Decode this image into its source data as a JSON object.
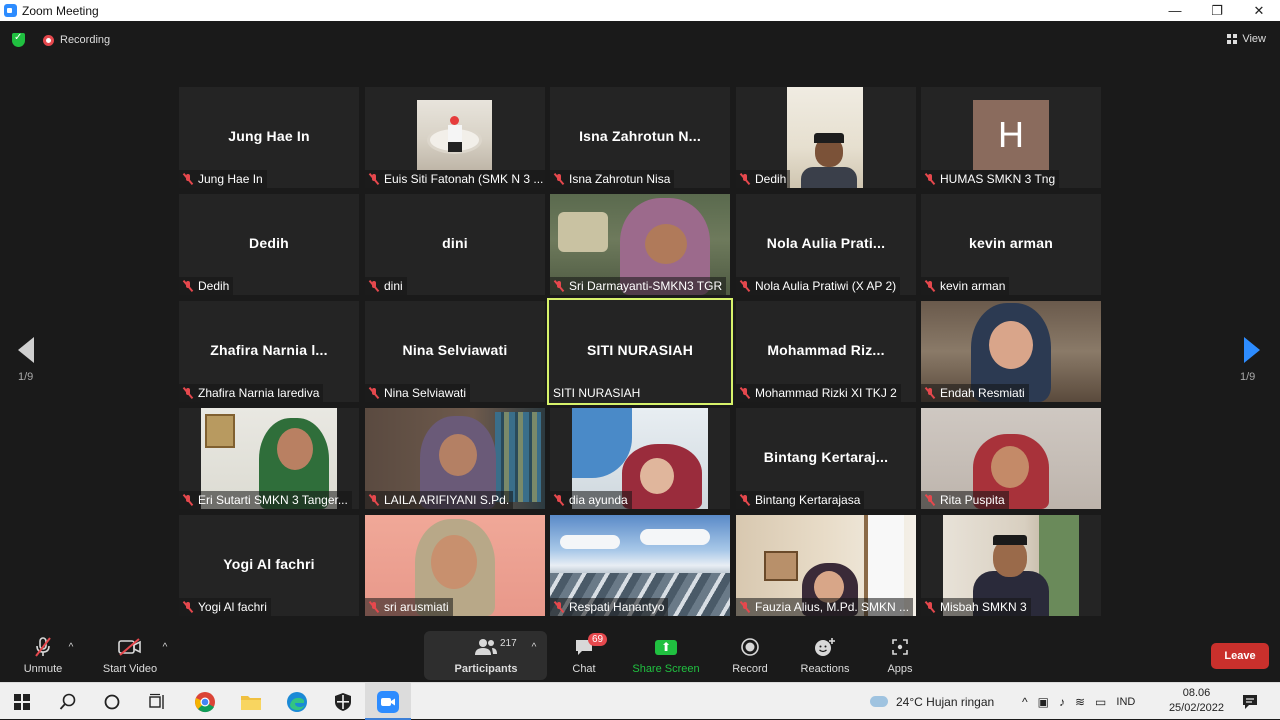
{
  "window": {
    "title": "Zoom Meeting",
    "minimize": "—",
    "restore": "❐",
    "close": "✕"
  },
  "topbar": {
    "recording_label": "Recording",
    "view_label": "View"
  },
  "pager": {
    "left_page": "1/9",
    "right_page": "1/9"
  },
  "tiles": [
    {
      "big": "Jung Hae In",
      "label": "Jung Hae In"
    },
    {
      "big": "",
      "label": "Euis Siti Fatonah (SMK N 3 ..."
    },
    {
      "big": "Isna Zahrotun N...",
      "label": "Isna Zahrotun Nisa"
    },
    {
      "big": "",
      "label": "Dedih"
    },
    {
      "big": "",
      "label": "HUMAS SMKN 3 Tng",
      "avatar": "H"
    },
    {
      "big": "Dedih",
      "label": "Dedih"
    },
    {
      "big": "dini",
      "label": "dini"
    },
    {
      "big": "",
      "label": "Sri Darmayanti-SMKN3 TGR"
    },
    {
      "big": "Nola Aulia Prati...",
      "label": "Nola Aulia Pratiwi (X AP 2)"
    },
    {
      "big": "kevin arman",
      "label": "kevin arman"
    },
    {
      "big": "Zhafira Narnia l...",
      "label": "Zhafira Narnia larediva"
    },
    {
      "big": "Nina Selviawati",
      "label": "Nina Selviawati"
    },
    {
      "big": "SITI NURASIAH",
      "label": "SITI NURASIAH"
    },
    {
      "big": "Mohammad Riz...",
      "label": "Mohammad Rizki XI TKJ 2"
    },
    {
      "big": "",
      "label": "Endah Resmiati"
    },
    {
      "big": "",
      "label": "Eri Sutarti SMKN 3 Tanger..."
    },
    {
      "big": "",
      "label": "LAILA ARIFIYANI S.Pd."
    },
    {
      "big": "",
      "label": "dia ayunda"
    },
    {
      "big": "Bintang Kertaraj...",
      "label": "Bintang Kertarajasa"
    },
    {
      "big": "",
      "label": "Rita Puspita"
    },
    {
      "big": "Yogi Al fachri",
      "label": "Yogi Al fachri"
    },
    {
      "big": "",
      "label": "sri arusmiati"
    },
    {
      "big": "",
      "label": "Respati Hanantyo"
    },
    {
      "big": "",
      "label": "Fauzia Alius, M.Pd. SMKN ..."
    },
    {
      "big": "",
      "label": "Misbah SMKN 3"
    }
  ],
  "toolbar": {
    "unmute": "Unmute",
    "start_video": "Start Video",
    "participants": "Participants",
    "participants_count": "217",
    "chat": "Chat",
    "chat_badge": "69",
    "share_screen": "Share Screen",
    "record": "Record",
    "reactions": "Reactions",
    "apps": "Apps",
    "leave": "Leave",
    "caret": "^"
  },
  "taskbar": {
    "weather": "24°C  Hujan ringan",
    "language": "IND",
    "time": "08.06",
    "date": "25/02/2022"
  },
  "colors": {
    "zoom_blue": "#2d8cff",
    "leave_red": "#c9302c",
    "share_green": "#20c040",
    "active_speaker": "#d7f36b"
  }
}
